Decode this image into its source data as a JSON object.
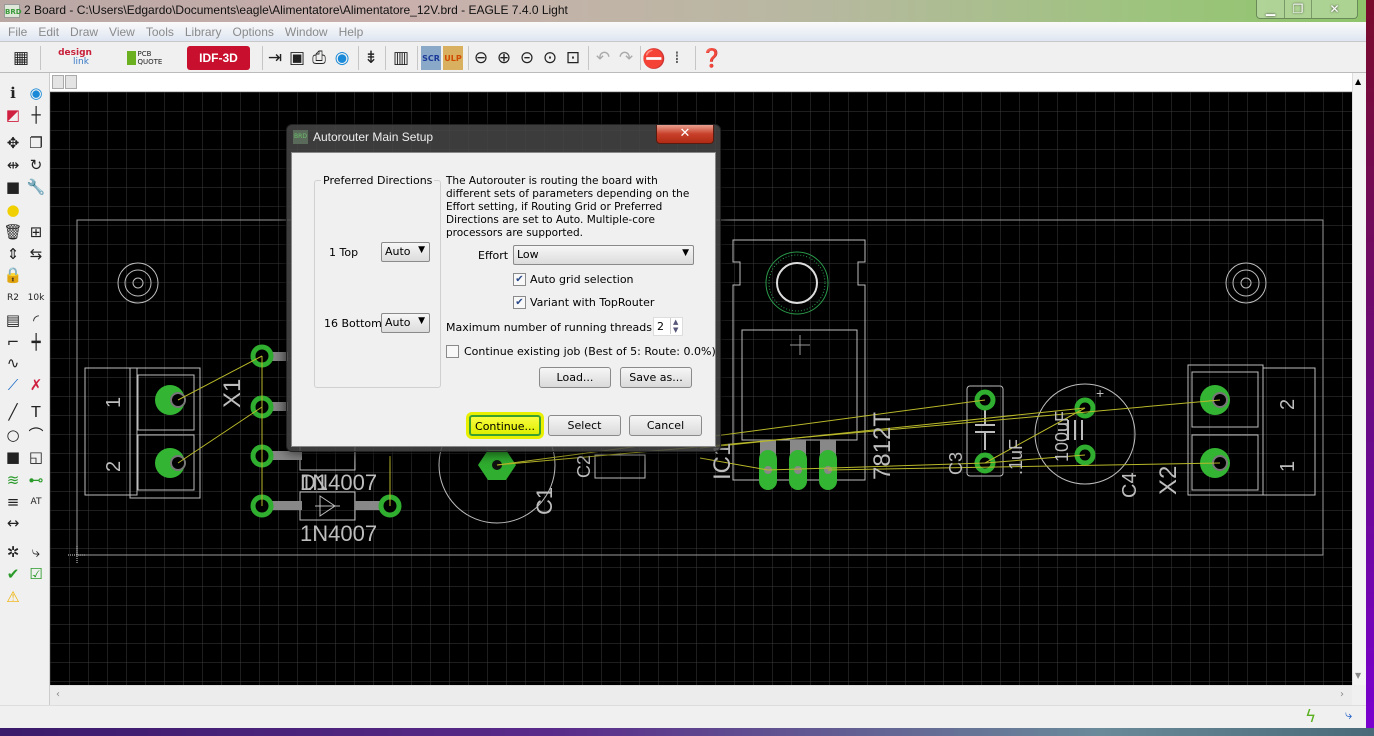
{
  "window": {
    "icon_text": "BRD",
    "title": "2 Board - C:\\Users\\Edgardo\\Documents\\eagle\\Alimentatore\\Alimentatore_12V.brd - EAGLE 7.4.0 Light"
  },
  "menu": [
    "File",
    "Edit",
    "Draw",
    "View",
    "Tools",
    "Library",
    "Options",
    "Window",
    "Help"
  ],
  "toolbar": {
    "design_link": "design",
    "design_link2": "link",
    "pcb_quote": "PCB QUOTE",
    "idf3d": "IDF-3D",
    "scr": "SCR",
    "ulp": "ULP"
  },
  "left_tools": [
    "info",
    "show",
    "display-layers",
    "mark",
    "move",
    "copy",
    "mirror",
    "rotate",
    "group",
    "change",
    "paste",
    "delete",
    "add",
    "pinswap",
    "replace",
    "lock",
    "name",
    "value",
    "smash",
    "miter",
    "split",
    "optimize",
    "meander",
    "route",
    "ripup",
    "wire",
    "text",
    "circle",
    "arc",
    "rect",
    "polygon",
    "via",
    "signal",
    "hole",
    "attribute",
    "dimension",
    "ratsnest",
    "autorouter",
    "erc",
    "drc",
    "errors"
  ],
  "board": {
    "x1": "X1",
    "x2": "X2",
    "pin1": "1",
    "pin2": "2",
    "d1": "D1",
    "diode": "1N4007",
    "c1": "C1",
    "c2": "C2",
    "c3": "C3",
    "c4": "C4",
    "ic": "IC1",
    "reg": "7812T",
    "c3val": ".1uF",
    "c4val": "100uF",
    "plus": "+"
  },
  "colors": {
    "pad": "#2fae2f",
    "airwire": "#b8b82a",
    "silk": "#bdbdbd",
    "grid": "#3a3a3a",
    "highlight": "#e8f000"
  },
  "dialog": {
    "icon_text": "BRD",
    "title": "Autorouter Main Setup",
    "group_label": "Preferred Directions",
    "layers": [
      {
        "label": "1  Top",
        "value": "Auto"
      },
      {
        "label": "16  Bottom",
        "value": "Auto"
      }
    ],
    "description": [
      "The Autorouter is routing the board with",
      "different sets of parameters depending on the",
      "Effort setting, if Routing Grid or Preferred",
      "Directions are set to Auto. Multiple-core",
      "processors are supported."
    ],
    "effort_label": "Effort",
    "effort_value": "Low",
    "auto_grid": {
      "label": "Auto grid selection",
      "checked": true
    },
    "variant": {
      "label": "Variant with TopRouter",
      "checked": true
    },
    "threads_label": "Maximum number of running threads",
    "threads_value": "2",
    "continue_job": {
      "label": "Continue existing job (Best of 5: Route: 0.0%)",
      "checked": false
    },
    "load": "Load...",
    "save_as": "Save as...",
    "continue": "Continue...",
    "select": "Select",
    "cancel": "Cancel"
  }
}
